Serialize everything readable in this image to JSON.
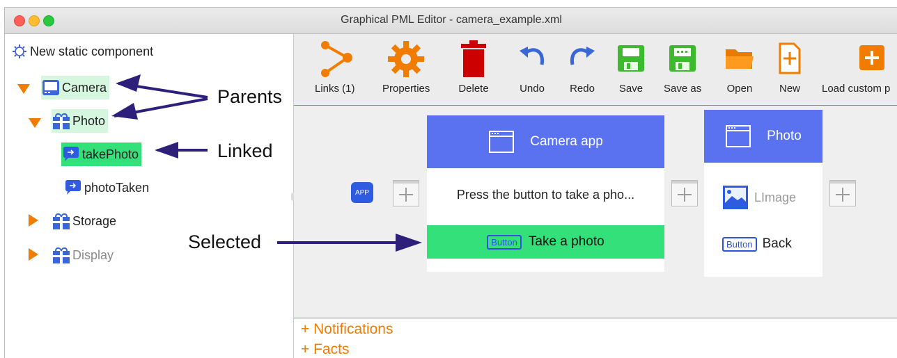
{
  "window": {
    "title": "Graphical PML Editor - camera_example.xml"
  },
  "tree": {
    "root_label": "New static component",
    "items": [
      {
        "label": "Camera"
      },
      {
        "label": "Photo"
      },
      {
        "label": "takePhoto"
      },
      {
        "label": "photoTaken"
      },
      {
        "label": "Storage"
      },
      {
        "label": "Display"
      }
    ]
  },
  "toolbar": {
    "links_label": "Links (1)",
    "properties_label": "Properties",
    "delete_label": "Delete",
    "undo_label": "Undo",
    "redo_label": "Redo",
    "save_label": "Save",
    "save_as_label": "Save as",
    "open_label": "Open",
    "new_label": "New",
    "load_custom_label": "Load custom p"
  },
  "canvas": {
    "app_badge": "APP",
    "camera_card": {
      "title": "Camera app",
      "text": "Press the button to take a pho...",
      "button_chip": "Button",
      "button_label": "Take a photo"
    },
    "photo_card": {
      "title": "Photo",
      "image_label": "LImage",
      "button_chip": "Button",
      "button_label": "Back"
    }
  },
  "sections": {
    "notifications": "+ Notifications",
    "facts": "+ Facts"
  },
  "annotations": {
    "parents": "Parents",
    "linked": "Linked",
    "selected": "Selected"
  },
  "colors": {
    "accent_blue": "#5a72f0",
    "selected_green": "#33e07a",
    "orange": "#f07d00",
    "annotation_arrow": "#2e1f7a"
  }
}
